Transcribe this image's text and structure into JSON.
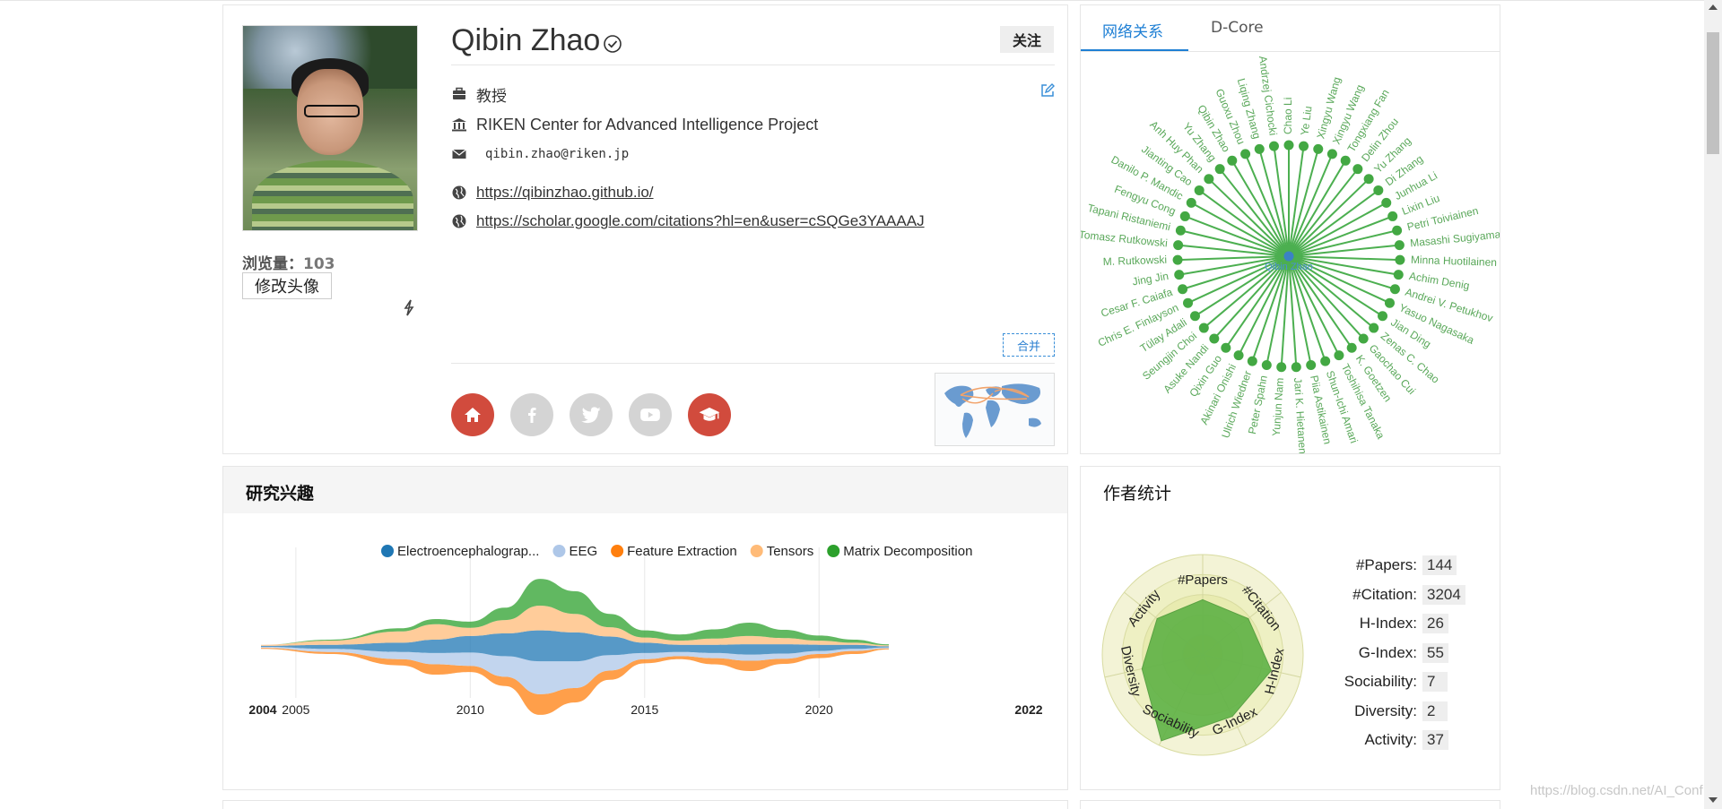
{
  "profile": {
    "name": "Qibin Zhao",
    "views_label": "浏览量：",
    "views_count": "103",
    "change_avatar": "修改头像",
    "follow": "关注",
    "position": "教授",
    "affiliation": "RIKEN Center for Advanced Intelligence Project",
    "email": "qibin.zhao@riken.jp",
    "homepage": "https://qibinzhao.github.io/",
    "scholar": "https://scholar.google.com/citations?hl=en&user=cSQGe3YAAAAJ",
    "merge": "合并",
    "social": [
      {
        "name": "home",
        "active": true
      },
      {
        "name": "facebook",
        "active": false
      },
      {
        "name": "twitter",
        "active": false
      },
      {
        "name": "youtube",
        "active": false
      },
      {
        "name": "scholar",
        "active": true
      }
    ]
  },
  "network": {
    "tabs": [
      "网络关系",
      "D-Core"
    ],
    "center": "Qibin Zhao",
    "nodes": [
      "Chao Li",
      "Ye Liu",
      "Xingyu Wang",
      "Xingyu Wang",
      "Tongxiang Fan",
      "Delin Zhou",
      "Yu Zhang",
      "Di Zhang",
      "Junhua Li",
      "Lixin Liu",
      "Petri Toiviainen",
      "Masashi Sugiyama",
      "Minna Huotilainen",
      "Achim Denig",
      "Andrei V. Petukhov",
      "Yasuo Nagasaka",
      "Jian Ding",
      "Zenas C. Chao",
      "Gaochao Cui",
      "K. Goetzen",
      "Toshihisa Tanaka",
      "Shun-Ichi Amari",
      "Piia Astikainen",
      "Jari K. Hietanen",
      "Yunjun Nam",
      "Peter Spahn",
      "Ulrich Wiedner",
      "Akinari Onishi",
      "Qixin Guo",
      "Asuke Nandi",
      "Seungjin Choi",
      "Tülay Adali",
      "Chris E. Finlayson",
      "Cesar F. Caiafa",
      "Jing Jin",
      "M. Rutkowski",
      "Tomasz Rutkowski",
      "Tapani Ristaniemi",
      "Fengyu Cong",
      "Danilo P. Mandic",
      "Jianting Cao",
      "Anh Huy Phan",
      "Yu Zhang",
      "Qibin Zhao",
      "Guoxu Zhou",
      "Liqing Zhang",
      "Andrzej Cichocki"
    ],
    "colors": {
      "line": "#4caf50",
      "node": "#43a843",
      "center": "#3b82c4",
      "label": "#5aa85a"
    }
  },
  "interests": {
    "title": "研究兴趣",
    "chart_data": {
      "type": "area",
      "subtype": "streamgraph",
      "x": [
        2004,
        2006,
        2008,
        2009,
        2010,
        2011,
        2012,
        2013,
        2014,
        2015,
        2016,
        2017,
        2018,
        2019,
        2020,
        2021,
        2022
      ],
      "xticks": [
        2005,
        2010,
        2015,
        2020
      ],
      "xrange_labels": [
        "2004",
        "2022"
      ],
      "series": [
        {
          "name": "Electroencephalograp...",
          "color": "#1f77b4",
          "values": [
            0.1,
            0.4,
            0.9,
            1.3,
            1.6,
            2.2,
            3.0,
            2.8,
            1.8,
            1.0,
            0.7,
            0.8,
            1.0,
            0.9,
            0.6,
            0.4,
            0.1
          ]
        },
        {
          "name": "EEG",
          "color": "#aec7e8",
          "values": [
            0.1,
            0.3,
            0.7,
            1.1,
            1.3,
            2.0,
            3.2,
            2.6,
            1.5,
            0.6,
            0.4,
            0.5,
            0.6,
            0.5,
            0.3,
            0.2,
            0.1
          ]
        },
        {
          "name": "Feature Extraction",
          "color": "#ff7f0e",
          "values": [
            0.1,
            0.2,
            0.6,
            1.0,
            0.6,
            0.9,
            2.0,
            1.4,
            0.9,
            0.4,
            0.3,
            0.6,
            1.0,
            0.5,
            0.4,
            0.3,
            0.1
          ]
        },
        {
          "name": "Tensors",
          "color": "#ffbb78",
          "values": [
            0.1,
            0.4,
            1.1,
            1.5,
            0.8,
            1.3,
            2.4,
            1.8,
            0.9,
            0.5,
            0.4,
            0.6,
            0.8,
            0.6,
            0.4,
            0.2,
            0.1
          ]
        },
        {
          "name": "Matrix Decomposition",
          "color": "#2ca02c",
          "values": [
            0.0,
            0.1,
            0.3,
            0.5,
            0.6,
            1.2,
            2.6,
            2.2,
            1.3,
            0.7,
            0.6,
            0.9,
            1.3,
            0.8,
            0.5,
            0.3,
            0.1
          ]
        }
      ]
    }
  },
  "stats": {
    "title": "作者统计",
    "items": [
      {
        "label": "#Papers:",
        "value": "144"
      },
      {
        "label": "#Citation:",
        "value": "3204"
      },
      {
        "label": "H-Index:",
        "value": "26"
      },
      {
        "label": "G-Index:",
        "value": "55"
      },
      {
        "label": "Sociability:",
        "value": "7"
      },
      {
        "label": "Diversity:",
        "value": "2"
      },
      {
        "label": "Activity:",
        "value": "37"
      }
    ],
    "radar": {
      "axes": [
        "#Papers",
        "#Citation",
        "H-Index",
        "G-Index",
        "Sociability",
        "Diversity",
        "Activity"
      ],
      "values": [
        0.55,
        0.58,
        0.7,
        0.68,
        0.95,
        0.62,
        0.58
      ],
      "fill": "#5fb246",
      "rings": [
        "#f3f3d6",
        "#eef0c3",
        "#e8ebb0",
        "#e2e69d",
        "#dbe08b"
      ]
    }
  },
  "watermark": "https://blog.csdn.net/AI_Conf"
}
